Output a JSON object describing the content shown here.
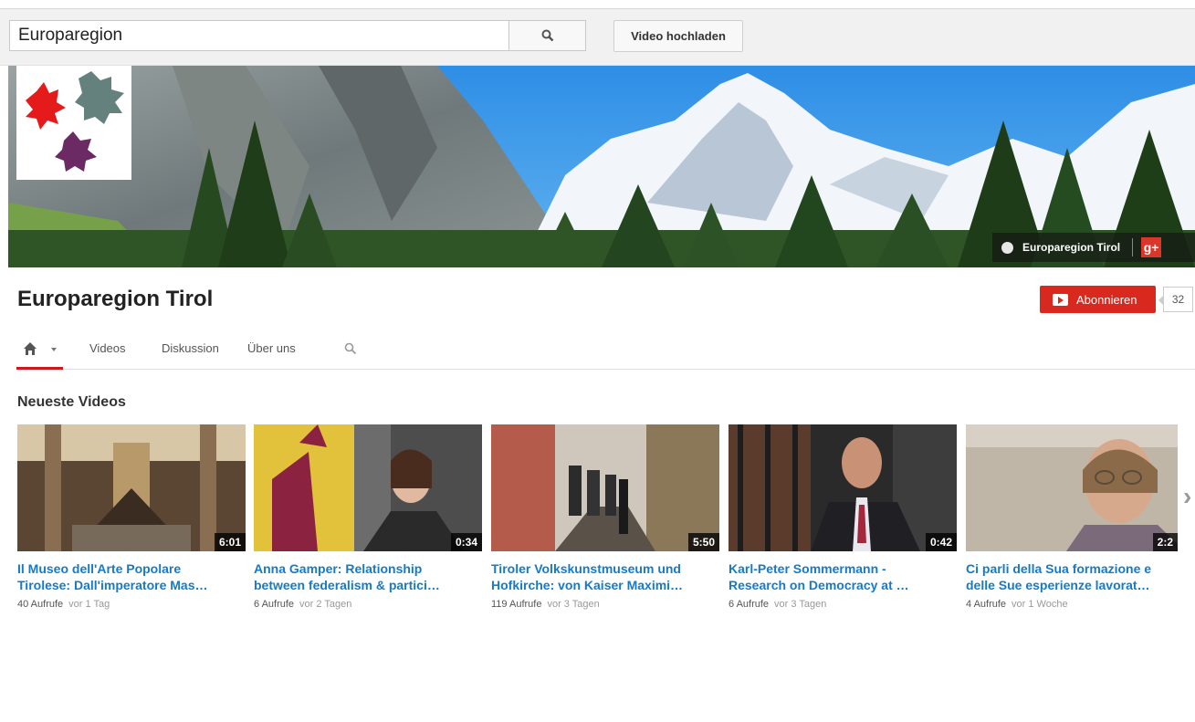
{
  "masthead": {
    "search_value": "Europaregion",
    "upload_label": "Video hochladen"
  },
  "banner": {
    "link_label": "Europaregion Tirol",
    "gplus_label": "g+"
  },
  "channel": {
    "title": "Europaregion Tirol",
    "subscribe_label": "Abonnieren",
    "subscriber_count": "32"
  },
  "tabs": {
    "videos": "Videos",
    "discussion": "Diskussion",
    "about": "Über uns"
  },
  "section": {
    "title": "Neueste Videos"
  },
  "videos": [
    {
      "duration": "6:01",
      "title_line1": "Il Museo dell'Arte Popolare",
      "title_line2": "Tirolese: Dall'imperatore Mas…",
      "views": "40 Aufrufe",
      "age": "vor 1 Tag"
    },
    {
      "duration": "0:34",
      "title_line1": "Anna Gamper: Relationship",
      "title_line2": "between federalism & partici…",
      "views": "6 Aufrufe",
      "age": "vor 2 Tagen"
    },
    {
      "duration": "5:50",
      "title_line1": "Tiroler Volkskunstmuseum und",
      "title_line2": "Hofkirche: von Kaiser Maximi…",
      "views": "119 Aufrufe",
      "age": "vor 3 Tagen"
    },
    {
      "duration": "0:42",
      "title_line1": "Karl-Peter Sommermann -",
      "title_line2": "Research on Democracy at …",
      "views": "6 Aufrufe",
      "age": "vor 3 Tagen"
    },
    {
      "duration": "2:2",
      "title_line1": "Ci parli della Sua formazione e",
      "title_line2": "delle Sue esperienze lavorat…",
      "views": "4 Aufrufe",
      "age": "vor 1 Woche"
    }
  ],
  "icons": {
    "search": "search-icon",
    "home": "home-icon",
    "next": "chevron-right-icon"
  },
  "colors": {
    "accent_red": "#d9281e",
    "link_blue": "#167ac6"
  }
}
